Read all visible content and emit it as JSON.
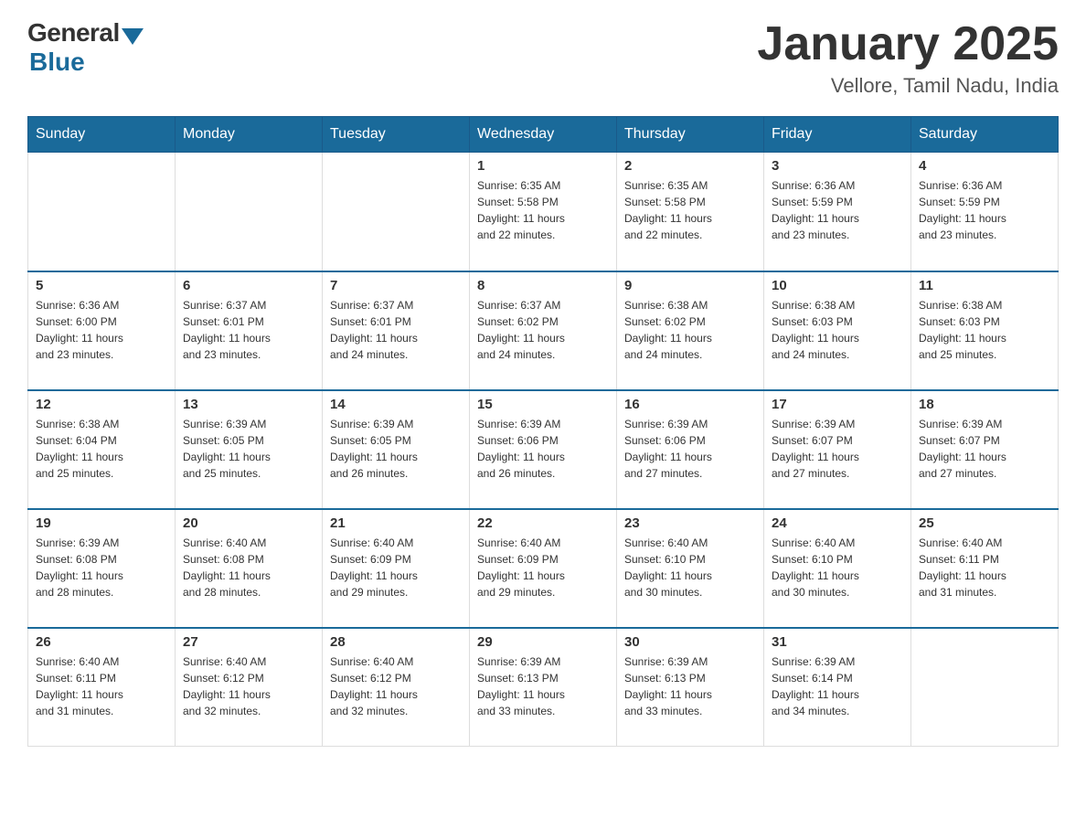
{
  "header": {
    "logo_general": "General",
    "logo_blue": "Blue",
    "title": "January 2025",
    "location": "Vellore, Tamil Nadu, India"
  },
  "days_of_week": [
    "Sunday",
    "Monday",
    "Tuesday",
    "Wednesday",
    "Thursday",
    "Friday",
    "Saturday"
  ],
  "weeks": [
    [
      {
        "day": "",
        "info": ""
      },
      {
        "day": "",
        "info": ""
      },
      {
        "day": "",
        "info": ""
      },
      {
        "day": "1",
        "info": "Sunrise: 6:35 AM\nSunset: 5:58 PM\nDaylight: 11 hours\nand 22 minutes."
      },
      {
        "day": "2",
        "info": "Sunrise: 6:35 AM\nSunset: 5:58 PM\nDaylight: 11 hours\nand 22 minutes."
      },
      {
        "day": "3",
        "info": "Sunrise: 6:36 AM\nSunset: 5:59 PM\nDaylight: 11 hours\nand 23 minutes."
      },
      {
        "day": "4",
        "info": "Sunrise: 6:36 AM\nSunset: 5:59 PM\nDaylight: 11 hours\nand 23 minutes."
      }
    ],
    [
      {
        "day": "5",
        "info": "Sunrise: 6:36 AM\nSunset: 6:00 PM\nDaylight: 11 hours\nand 23 minutes."
      },
      {
        "day": "6",
        "info": "Sunrise: 6:37 AM\nSunset: 6:01 PM\nDaylight: 11 hours\nand 23 minutes."
      },
      {
        "day": "7",
        "info": "Sunrise: 6:37 AM\nSunset: 6:01 PM\nDaylight: 11 hours\nand 24 minutes."
      },
      {
        "day": "8",
        "info": "Sunrise: 6:37 AM\nSunset: 6:02 PM\nDaylight: 11 hours\nand 24 minutes."
      },
      {
        "day": "9",
        "info": "Sunrise: 6:38 AM\nSunset: 6:02 PM\nDaylight: 11 hours\nand 24 minutes."
      },
      {
        "day": "10",
        "info": "Sunrise: 6:38 AM\nSunset: 6:03 PM\nDaylight: 11 hours\nand 24 minutes."
      },
      {
        "day": "11",
        "info": "Sunrise: 6:38 AM\nSunset: 6:03 PM\nDaylight: 11 hours\nand 25 minutes."
      }
    ],
    [
      {
        "day": "12",
        "info": "Sunrise: 6:38 AM\nSunset: 6:04 PM\nDaylight: 11 hours\nand 25 minutes."
      },
      {
        "day": "13",
        "info": "Sunrise: 6:39 AM\nSunset: 6:05 PM\nDaylight: 11 hours\nand 25 minutes."
      },
      {
        "day": "14",
        "info": "Sunrise: 6:39 AM\nSunset: 6:05 PM\nDaylight: 11 hours\nand 26 minutes."
      },
      {
        "day": "15",
        "info": "Sunrise: 6:39 AM\nSunset: 6:06 PM\nDaylight: 11 hours\nand 26 minutes."
      },
      {
        "day": "16",
        "info": "Sunrise: 6:39 AM\nSunset: 6:06 PM\nDaylight: 11 hours\nand 27 minutes."
      },
      {
        "day": "17",
        "info": "Sunrise: 6:39 AM\nSunset: 6:07 PM\nDaylight: 11 hours\nand 27 minutes."
      },
      {
        "day": "18",
        "info": "Sunrise: 6:39 AM\nSunset: 6:07 PM\nDaylight: 11 hours\nand 27 minutes."
      }
    ],
    [
      {
        "day": "19",
        "info": "Sunrise: 6:39 AM\nSunset: 6:08 PM\nDaylight: 11 hours\nand 28 minutes."
      },
      {
        "day": "20",
        "info": "Sunrise: 6:40 AM\nSunset: 6:08 PM\nDaylight: 11 hours\nand 28 minutes."
      },
      {
        "day": "21",
        "info": "Sunrise: 6:40 AM\nSunset: 6:09 PM\nDaylight: 11 hours\nand 29 minutes."
      },
      {
        "day": "22",
        "info": "Sunrise: 6:40 AM\nSunset: 6:09 PM\nDaylight: 11 hours\nand 29 minutes."
      },
      {
        "day": "23",
        "info": "Sunrise: 6:40 AM\nSunset: 6:10 PM\nDaylight: 11 hours\nand 30 minutes."
      },
      {
        "day": "24",
        "info": "Sunrise: 6:40 AM\nSunset: 6:10 PM\nDaylight: 11 hours\nand 30 minutes."
      },
      {
        "day": "25",
        "info": "Sunrise: 6:40 AM\nSunset: 6:11 PM\nDaylight: 11 hours\nand 31 minutes."
      }
    ],
    [
      {
        "day": "26",
        "info": "Sunrise: 6:40 AM\nSunset: 6:11 PM\nDaylight: 11 hours\nand 31 minutes."
      },
      {
        "day": "27",
        "info": "Sunrise: 6:40 AM\nSunset: 6:12 PM\nDaylight: 11 hours\nand 32 minutes."
      },
      {
        "day": "28",
        "info": "Sunrise: 6:40 AM\nSunset: 6:12 PM\nDaylight: 11 hours\nand 32 minutes."
      },
      {
        "day": "29",
        "info": "Sunrise: 6:39 AM\nSunset: 6:13 PM\nDaylight: 11 hours\nand 33 minutes."
      },
      {
        "day": "30",
        "info": "Sunrise: 6:39 AM\nSunset: 6:13 PM\nDaylight: 11 hours\nand 33 minutes."
      },
      {
        "day": "31",
        "info": "Sunrise: 6:39 AM\nSunset: 6:14 PM\nDaylight: 11 hours\nand 34 minutes."
      },
      {
        "day": "",
        "info": ""
      }
    ]
  ]
}
